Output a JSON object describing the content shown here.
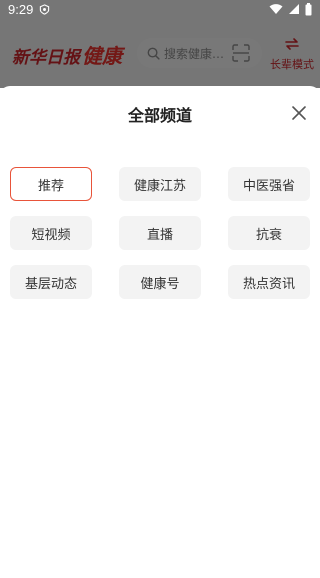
{
  "status_bar": {
    "time": "9:29",
    "icons": [
      "notification-icon",
      "wifi-icon",
      "signal-icon",
      "battery-icon"
    ]
  },
  "app_header": {
    "logo_text": "新华日报",
    "logo_sub": "健康",
    "search_placeholder": "搜索健康…",
    "mode_label": "长辈模式"
  },
  "sheet": {
    "title": "全部频道",
    "channels": [
      {
        "label": "推荐",
        "active": true
      },
      {
        "label": "健康江苏",
        "active": false
      },
      {
        "label": "中医强省",
        "active": false
      },
      {
        "label": "短视频",
        "active": false
      },
      {
        "label": "直播",
        "active": false
      },
      {
        "label": "抗衰",
        "active": false
      },
      {
        "label": "基层动态",
        "active": false
      },
      {
        "label": "健康号",
        "active": false
      },
      {
        "label": "热点资讯",
        "active": false
      }
    ]
  },
  "colors": {
    "brand_red": "#c9252b",
    "active_border": "#e8543a",
    "chip_bg": "#f3f3f3"
  }
}
